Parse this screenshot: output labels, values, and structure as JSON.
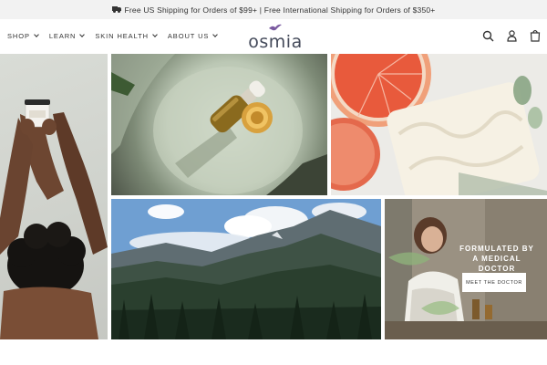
{
  "announcement": {
    "text": "Free US Shipping for Orders of $99+ | Free International Shipping for Orders of $350+",
    "icon": "truck-icon"
  },
  "nav": {
    "items": [
      {
        "label": "SHOP"
      },
      {
        "label": "LEARN"
      },
      {
        "label": "SKIN HEALTH"
      },
      {
        "label": "ABOUT US"
      }
    ]
  },
  "logo": {
    "text": "osmia"
  },
  "header_icons": [
    "search-icon",
    "account-icon",
    "cart-icon"
  ],
  "hero": {
    "tiles": [
      {
        "name": "woman-holding-jar",
        "alt": "Woman holding cream jar"
      },
      {
        "name": "dropper-bottle",
        "alt": "Oil dropper bottle on dish"
      },
      {
        "name": "grapefruit-soap",
        "alt": "Grapefruit and soap bar"
      },
      {
        "name": "mountain-landscape",
        "alt": "Mountain valley landscape"
      },
      {
        "name": "doctor-portrait",
        "alt": "Doctor in apothecary"
      }
    ],
    "overlay_title": "FORMULATED BY A MEDICAL DOCTOR",
    "overlay_button": "MEET THE DOCTOR"
  },
  "colors": {
    "announce_bg": "#f2f2f2",
    "logo": "#444a5a",
    "bird": "#7a5aa0",
    "text": "#333333"
  }
}
